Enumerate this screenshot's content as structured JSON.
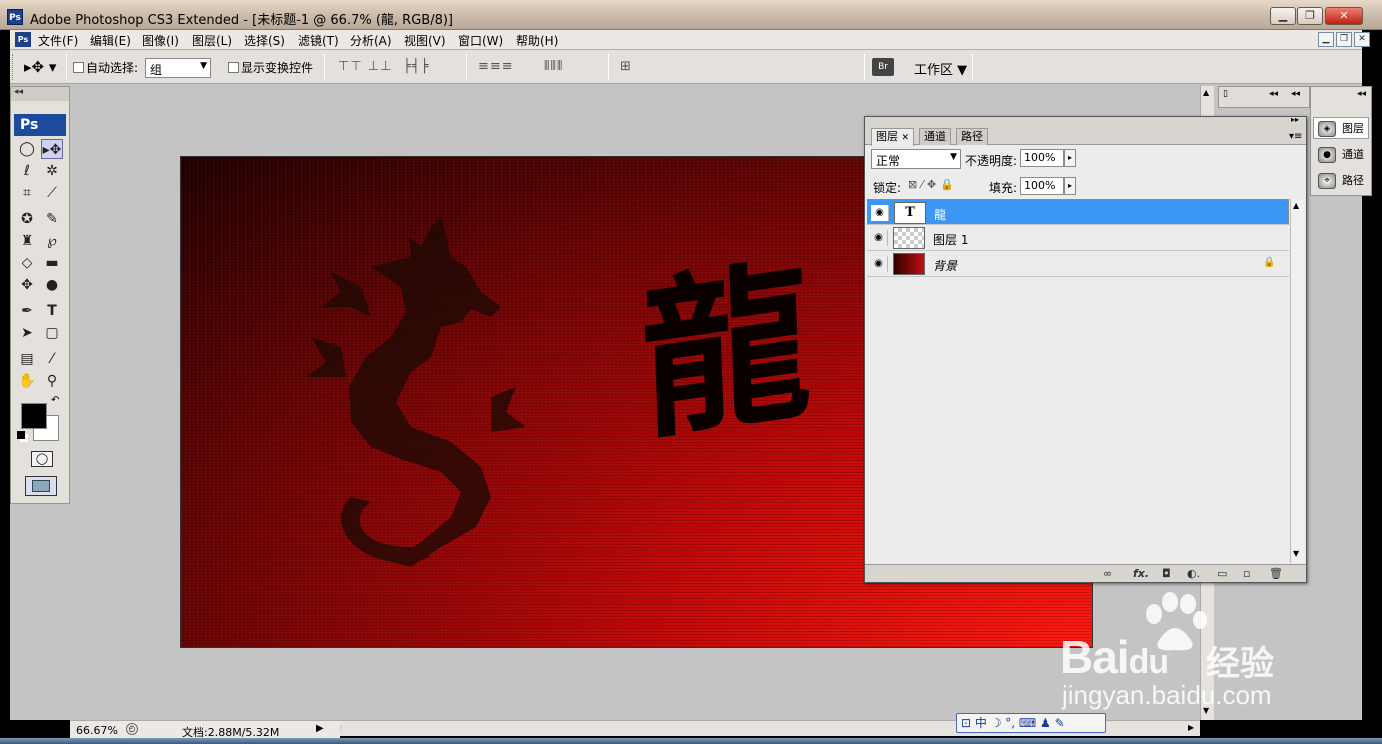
{
  "window": {
    "logo": "Ps",
    "title": "Adobe Photoshop CS3 Extended - [未标题-1 @ 66.7% (龍, RGB/8)]",
    "minimize_label": "▁",
    "maximize_label": "❐",
    "close_label": "✕"
  },
  "menu": {
    "items": [
      "文件(F)",
      "编辑(E)",
      "图像(I)",
      "图层(L)",
      "选择(S)",
      "滤镜(T)",
      "分析(A)",
      "视图(V)",
      "窗口(W)",
      "帮助(H)"
    ]
  },
  "options": {
    "auto_select_label": "自动选择:",
    "auto_select_value": "组",
    "show_transform_label": "显示变换控件",
    "workspace_label": "工作区 ▼",
    "align_icons": "⊤⊤ ⊥⊥",
    "align_icons2": "╞╡╞",
    "distribute_icons": "≡≡≡",
    "distribute_icons2": "⫴⫴⫴",
    "auto_align_icon": "⊞"
  },
  "toolbox": {
    "header": "◂◂",
    "logo": "Ps"
  },
  "canvas": {
    "text_layer": "龍"
  },
  "status": {
    "zoom": "66.67%",
    "doc_info": "文档:2.88M/5.32M",
    "arrow": "▶"
  },
  "dock": {
    "items": [
      "图层",
      "通道",
      "路径"
    ]
  },
  "layers_panel": {
    "tabs": [
      "图层",
      "通道",
      "路径"
    ],
    "blend_mode": "正常",
    "opacity_label": "不透明度:",
    "opacity_value": "100%",
    "lock_label": "锁定:",
    "fill_label": "填充:",
    "fill_value": "100%",
    "layers": [
      {
        "name": "龍",
        "thumb": "T",
        "selected": true
      },
      {
        "name": "图层 1",
        "thumb": "",
        "selected": false
      },
      {
        "name": "背景",
        "thumb": "",
        "selected": false,
        "locked": true
      }
    ],
    "bottom_icons": [
      "∞",
      "fx.",
      "◘",
      "◐.",
      "▭",
      "▫",
      "🗑"
    ]
  },
  "watermark": {
    "brand": "Bai",
    "brand2": "du",
    "cn": "经验",
    "url": "jingyan.baidu.com"
  },
  "ime": {
    "text": "中 ☽ °, ⌨ ♟ ✎"
  },
  "colors": {
    "accent": "#3b96f4",
    "canvas_red": "#e01010"
  }
}
